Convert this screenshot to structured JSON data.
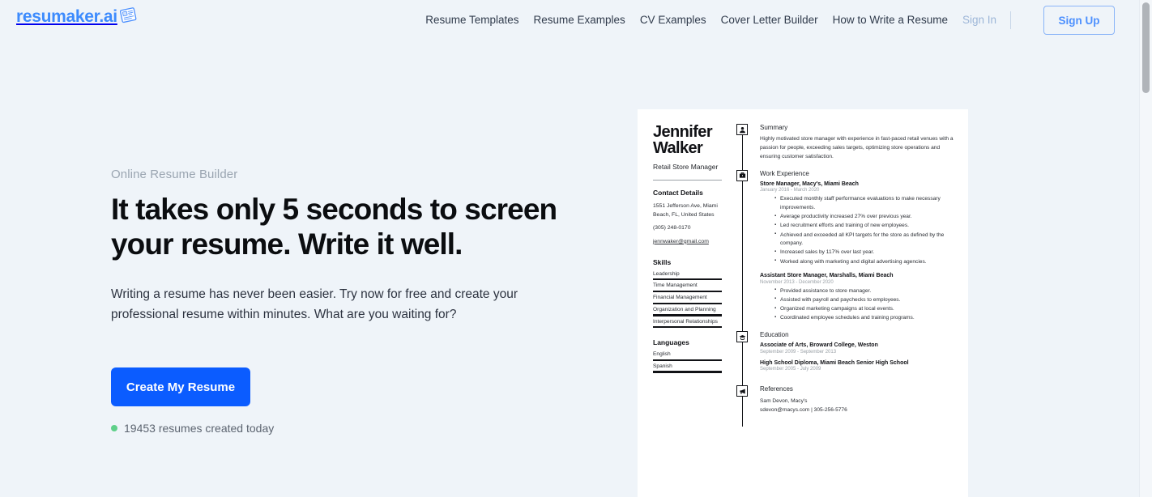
{
  "brand": {
    "name": "resumaker.ai",
    "logo_icon": "resume-document-icon",
    "color": "#3d8bfd"
  },
  "nav": {
    "items": [
      {
        "label": "Resume Templates"
      },
      {
        "label": "Resume Examples"
      },
      {
        "label": "CV Examples"
      },
      {
        "label": "Cover Letter Builder"
      },
      {
        "label": "How to Write a Resume"
      }
    ],
    "sign_in": "Sign In",
    "sign_up": "Sign Up"
  },
  "hero": {
    "eyebrow": "Online Resume Builder",
    "headline": "It takes only 5 seconds to screen your resume. Write it well.",
    "subcopy": "Writing a resume has never been easier. Try now for free and create your professional resume within minutes. What are you waiting for?",
    "cta_label": "Create My Resume",
    "counter_text": "19453 resumes created today",
    "counter_dot_color": "#5fd08a",
    "cta_color": "#0b5cff"
  },
  "resume": {
    "name": "Jennifer Walker",
    "title": "Retail Store Manager",
    "contact": {
      "heading": "Contact Details",
      "address_line1": "1551 Jefferson Ave, Miami",
      "address_line2": "Beach, FL, United States",
      "phone": "(305) 248-0170",
      "email": "jennwaker@gmail.com"
    },
    "skills": {
      "heading": "Skills",
      "items": [
        "Leadership",
        "Time Management",
        "Financial Management",
        "Organization and Planning",
        "Interpersonal Relationships"
      ]
    },
    "languages": {
      "heading": "Languages",
      "items": [
        "English",
        "Spanish"
      ]
    },
    "summary": {
      "heading": "Summary",
      "icon": "person-icon",
      "text": "Highly motivated store manager with experience in fast-paced retail venues with a passion for people, exceeding sales targets, optimizing store operations and ensuring customer satisfaction."
    },
    "work": {
      "heading": "Work Experience",
      "icon": "briefcase-icon",
      "jobs": [
        {
          "title": "Store Manager, Macy's, Miami Beach",
          "date": "January 2016 - March 2020",
          "bullets": [
            "Executed monthly staff performance evaluations to make necessary improvements.",
            "Average productivity increased 27% over previous year.",
            "Led recruitment efforts and training of new employees.",
            "Achieved and exceeded all KPI targets for the store as defined by the company.",
            "Increased sales by 117% over last year.",
            "Worked along with marketing and digital advertising agencies."
          ]
        },
        {
          "title": "Assistant Store Manager, Marshalls, Miami Beach",
          "date": "November 2013 - December 2020",
          "bullets": [
            "Provided assistance to store manager.",
            "Assisted with payroll and paychecks to employees.",
            "Organized marketing campaigns at local events.",
            "Coordinated employee schedules and training programs."
          ]
        }
      ]
    },
    "education": {
      "heading": "Education",
      "icon": "graduation-cap-icon",
      "items": [
        {
          "title": "Associate of Arts, Broward College, Weston",
          "date": "September 2009 - September 2013"
        },
        {
          "title": "High School Diploma, Miami Beach Senior High School",
          "date": "September 2005 - July 2009"
        }
      ]
    },
    "references": {
      "heading": "References",
      "icon": "megaphone-icon",
      "name": "Sam Devon, Macy's",
      "contact": "sdevon@macys.com | 305-256-5776"
    }
  }
}
